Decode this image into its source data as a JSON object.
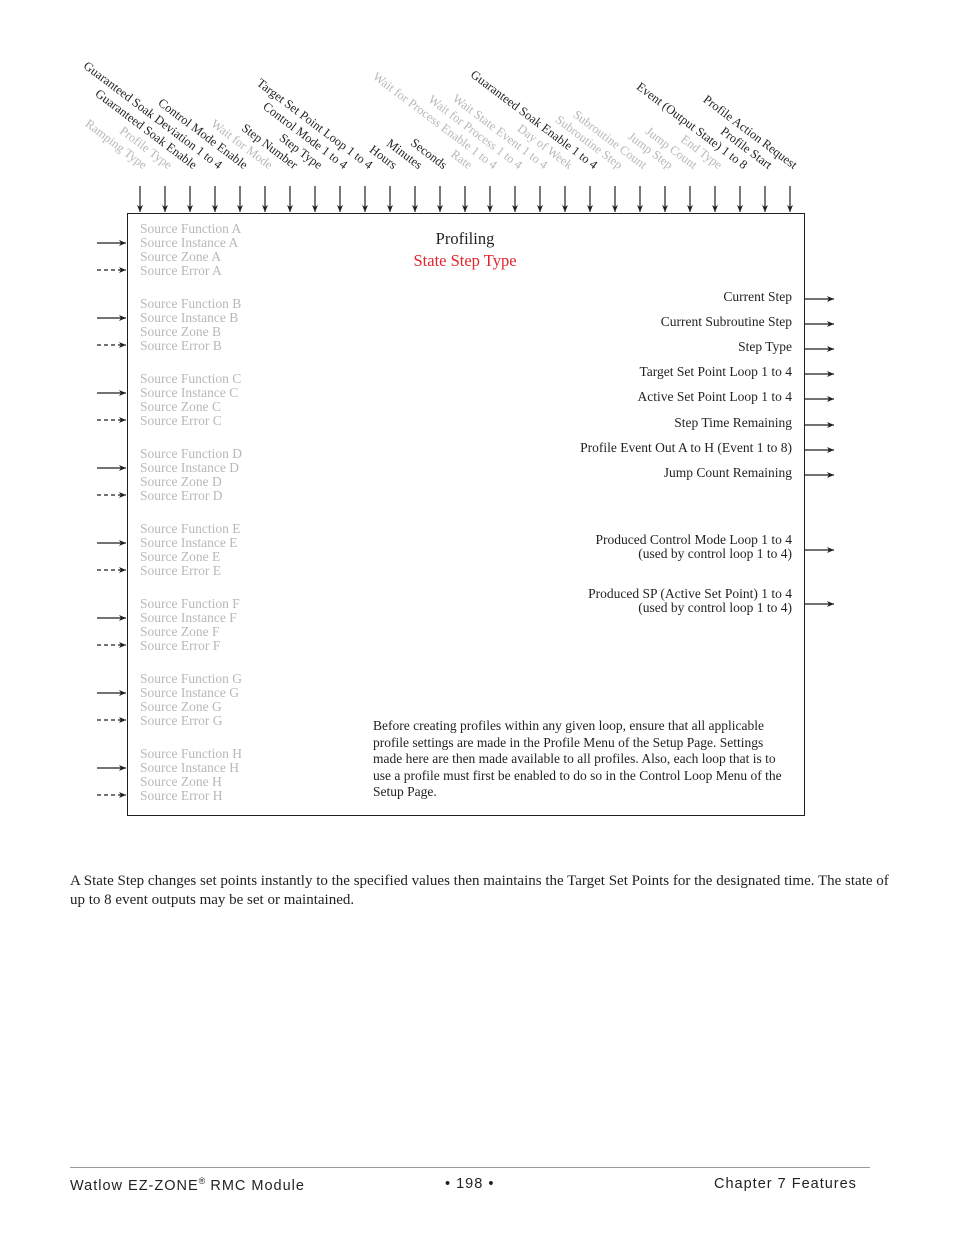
{
  "diagram": {
    "title": "Profiling",
    "subtitle": "State Step Type",
    "subtitle_color": "#e4232b",
    "inactive_color": "#b8b8b8",
    "inputs_top": [
      {
        "label": "Ramping Type",
        "active": false
      },
      {
        "label": "Profile Type",
        "active": false
      },
      {
        "label": "Guaranteed Soak Enable",
        "active": true
      },
      {
        "label": "Guaranteed Soak Deviation 1 to 4",
        "active": true
      },
      {
        "label": "Control Mode Enable",
        "active": true
      },
      {
        "label": "Wait for Mode",
        "active": false
      },
      {
        "label": "Step Number",
        "active": true
      },
      {
        "label": "Step Type",
        "active": true
      },
      {
        "label": "Control Mode 1 to 4",
        "active": true
      },
      {
        "label": "Target Set Point Loop 1 to 4",
        "active": true
      },
      {
        "label": "Hours",
        "active": true
      },
      {
        "label": "Minutes",
        "active": true
      },
      {
        "label": "Seconds",
        "active": true
      },
      {
        "label": "Rate",
        "active": false
      },
      {
        "label": "Wait for Process Enable 1 to 4",
        "active": false
      },
      {
        "label": "Wait for Process 1 to 4",
        "active": false
      },
      {
        "label": "Wait State Event 1 to 4",
        "active": false
      },
      {
        "label": "Day of Week",
        "active": false
      },
      {
        "label": "Guaranteed Soak Enable 1 to 4",
        "active": true
      },
      {
        "label": "Subroutine Step",
        "active": false
      },
      {
        "label": "Subroutine Count",
        "active": false
      },
      {
        "label": "Jump Step",
        "active": false
      },
      {
        "label": "Jump Count",
        "active": false
      },
      {
        "label": "End Type",
        "active": false
      },
      {
        "label": "Event (Output State) 1 to 8",
        "active": true
      },
      {
        "label": "Profile Start",
        "active": true
      },
      {
        "label": "Profile Action Request",
        "active": true
      }
    ],
    "sources": [
      {
        "function": "Source Function A",
        "instance": "Source Instance A",
        "zone": "Source Zone A",
        "error": "Source Error A"
      },
      {
        "function": "Source Function B",
        "instance": "Source Instance B",
        "zone": "Source Zone B",
        "error": "Source Error B"
      },
      {
        "function": "Source Function C",
        "instance": "Source Instance C",
        "zone": "Source Zone C",
        "error": "Source Error C"
      },
      {
        "function": "Source Function D",
        "instance": "Source Instance D",
        "zone": "Source Zone D",
        "error": "Source Error D"
      },
      {
        "function": "Source Function E",
        "instance": "Source Instance E",
        "zone": "Source Zone E",
        "error": "Source Error E"
      },
      {
        "function": "Source Function F",
        "instance": "Source Instance F",
        "zone": "Source Zone F",
        "error": "Source Error F"
      },
      {
        "function": "Source Function G",
        "instance": "Source Instance G",
        "zone": "Source Zone G",
        "error": "Source Error G"
      },
      {
        "function": "Source Function H",
        "instance": "Source Instance H",
        "zone": "Source Zone H",
        "error": "Source Error H"
      }
    ],
    "outputs": [
      {
        "line1": "Current Step"
      },
      {
        "line1": "Current Subroutine Step"
      },
      {
        "line1": "Step Type"
      },
      {
        "line1": "Target Set Point Loop 1 to 4"
      },
      {
        "line1": "Active Set Point Loop 1 to 4"
      },
      {
        "line1": "Step Time Remaining"
      },
      {
        "line1": "Profile Event Out A to H (Event 1 to 8)"
      },
      {
        "line1": "Jump Count Remaining"
      },
      {
        "line1": "Produced Control Mode Loop 1 to 4",
        "line2": "(used by control loop 1 to 4)"
      },
      {
        "line1": "Produced SP (Active Set Point) 1 to 4",
        "line2": "(used by control loop 1 to 4)"
      }
    ],
    "note": "Before creating profiles within any given loop, ensure that all applicable profile settings are made in the Profile Menu of the Setup Page. Settings made here are then made available to all profiles. Also, each loop that is to use a profile must first be enabled to do so in the Control Loop Menu of the Setup Page."
  },
  "description": "A State Step changes set points instantly to the specified values then maintains the Target Set Points for the designated time.  The state of up to 8 event outputs may be set or maintained.",
  "footer": {
    "product": "Watlow EZ-ZONE",
    "registered": "®",
    "product_suffix": " RMC Module",
    "page": "•  198  •",
    "chapter": "Chapter 7 Features"
  }
}
